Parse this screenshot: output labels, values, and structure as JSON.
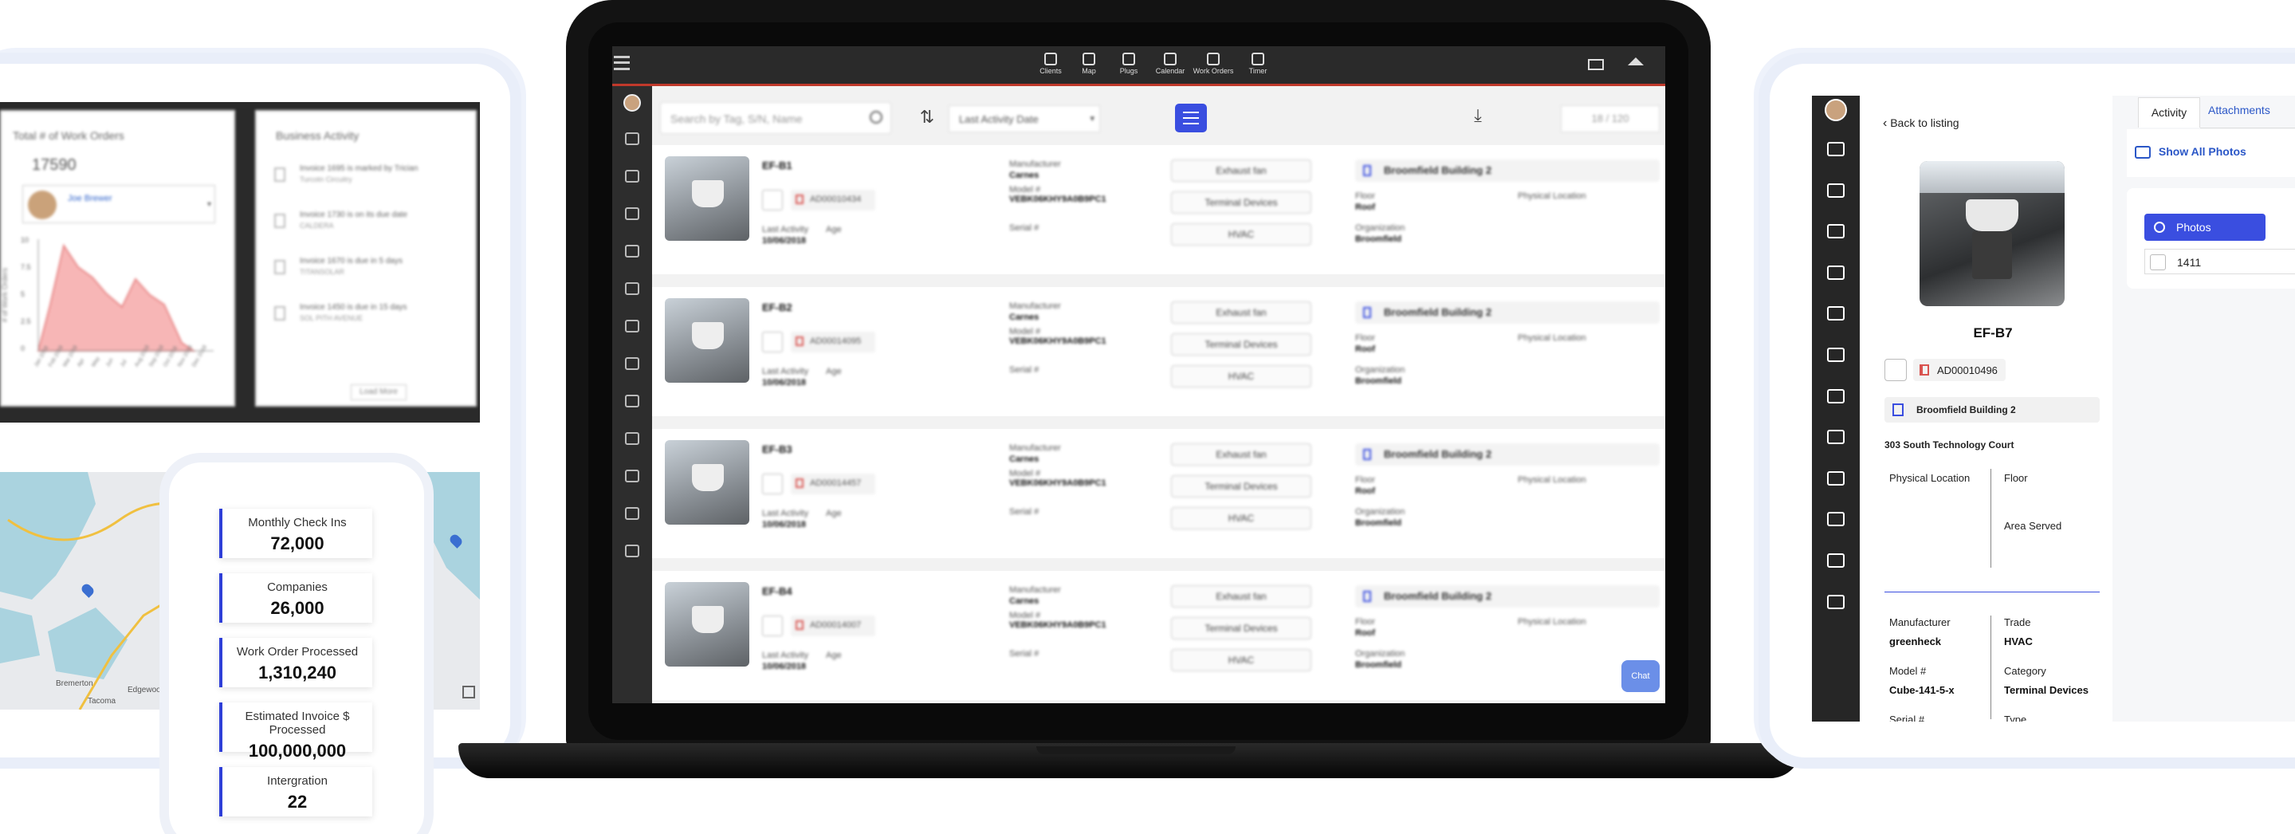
{
  "left_panel": {
    "work_orders_card": {
      "title": "Total # of Work Orders",
      "total": "17590",
      "user_name": "Joe Brewer",
      "y_axis_label": "# of Work Orders",
      "y_ticks": [
        "10",
        "7.5",
        "5",
        "2.5",
        "0"
      ],
      "x_ticks": [
        "Jan 2018",
        "Feb 2018",
        "Mar 2018",
        "Apr",
        "May",
        "Jun",
        "Jul",
        "Aug 2018",
        "Sep 2018",
        "Oct 2018",
        "Nov 2018",
        "Dec 2018"
      ]
    },
    "business_activity": {
      "title": "Business Activity",
      "items": [
        {
          "line1": "Invoice 1695 is marked by Trician",
          "line2": "Turcotn Circuitry"
        },
        {
          "line1": "Invoice 1730 is on its due date",
          "line2": "CALDERA"
        },
        {
          "line1": "Invoice 1670 is due in 5 days",
          "line2": "TITANSOLAR"
        },
        {
          "line1": "Invoice 1450 is due in 15 days",
          "line2": "SOL PITH AVENUE"
        }
      ],
      "load_more": "Load More"
    },
    "stats": [
      {
        "label": "Monthly Check Ins",
        "value": "72,000"
      },
      {
        "label": "Companies",
        "value": "26,000"
      },
      {
        "label": "Work Order Processed",
        "value": "1,310,240"
      },
      {
        "label": "Estimated Invoice $ Processed",
        "value": "100,000,000"
      },
      {
        "label": "Intergration",
        "value": "22"
      }
    ],
    "map_labels": [
      "Bremerton",
      "Edgewood",
      "Tacoma"
    ]
  },
  "laptop": {
    "nav": [
      {
        "icon": "clients-icon",
        "label": "Clients"
      },
      {
        "icon": "map-pin-icon",
        "label": "Map"
      },
      {
        "icon": "lightbulb-icon",
        "label": "Plugs"
      },
      {
        "icon": "calendar-icon",
        "label": "Calendar"
      },
      {
        "icon": "clipboard-icon",
        "label": "Work Orders"
      },
      {
        "icon": "timer-icon",
        "label": "Timer"
      }
    ],
    "search_placeholder": "Search by Tag, S/N, Name",
    "sort_value": "Last Activity Date",
    "pagination": "18 / 120",
    "chat_label": "Chat",
    "rows": [
      {
        "tag": "EF-B1",
        "id": "AD00010434",
        "last_activity_label": "Last Activity",
        "age_label": "Age",
        "last_activity": "10/06/2018",
        "manufacturer_label": "Manufacturer",
        "manufacturer": "Carnes",
        "model_label": "Model #",
        "model": "VEBK06KHY9A0B9PC1",
        "serial_label": "Serial #",
        "type": "Exhaust fan",
        "category": "Terminal Devices",
        "trade": "HVAC",
        "building": "Broomfield Building 2",
        "floor_label": "Floor",
        "floor": "Roof",
        "location_label": "Physical Location",
        "org_label": "Organization",
        "org": "Broomfield"
      },
      {
        "tag": "EF-B2",
        "id": "AD00014095",
        "last_activity_label": "Last Activity",
        "age_label": "Age",
        "last_activity": "10/06/2018",
        "manufacturer_label": "Manufacturer",
        "manufacturer": "Carnes",
        "model_label": "Model #",
        "model": "VEBK06KHY9A0B9PC1",
        "serial_label": "Serial #",
        "type": "Exhaust fan",
        "category": "Terminal Devices",
        "trade": "HVAC",
        "building": "Broomfield Building 2",
        "floor_label": "Floor",
        "floor": "Roof",
        "location_label": "Physical Location",
        "org_label": "Organization",
        "org": "Broomfield"
      },
      {
        "tag": "EF-B3",
        "id": "AD00014457",
        "last_activity_label": "Last Activity",
        "age_label": "Age",
        "last_activity": "10/06/2018",
        "manufacturer_label": "Manufacturer",
        "manufacturer": "Carnes",
        "model_label": "Model #",
        "model": "VEBK06KHY9A0B9PC1",
        "serial_label": "Serial #",
        "type": "Exhaust fan",
        "category": "Terminal Devices",
        "trade": "HVAC",
        "building": "Broomfield Building 2",
        "floor_label": "Floor",
        "floor": "Roof",
        "location_label": "Physical Location",
        "org_label": "Organization",
        "org": "Broomfield"
      },
      {
        "tag": "EF-B4",
        "id": "AD00014007",
        "last_activity_label": "Last Activity",
        "age_label": "Age",
        "last_activity": "10/06/2018",
        "manufacturer_label": "Manufacturer",
        "manufacturer": "Carnes",
        "model_label": "Model #",
        "model": "VEBK06KHY9A0B9PC1",
        "serial_label": "Serial #",
        "type": "Exhaust fan",
        "category": "Terminal Devices",
        "trade": "HVAC",
        "building": "Broomfield Building 2",
        "floor_label": "Floor",
        "floor": "Roof",
        "location_label": "Physical Location",
        "org_label": "Organization",
        "org": "Broomfield"
      }
    ]
  },
  "right_panel": {
    "back_link": "Back to listing",
    "asset_tag": "EF-B7",
    "asset_id": "AD00010496",
    "building": "Broomfield Building 2",
    "address": "303 South Technology Court",
    "physical_location_label": "Physical Location",
    "floor_label": "Floor",
    "area_served_label": "Area Served",
    "manufacturer_label": "Manufacturer",
    "manufacturer": "greenheck",
    "trade_label": "Trade",
    "trade": "HVAC",
    "model_label": "Model #",
    "model": "Cube-141-5-x",
    "category_label": "Category",
    "category": "Terminal Devices",
    "serial_label": "Serial #",
    "type_label": "Type",
    "tabs": [
      "Activity",
      "Attachments"
    ],
    "show_all_photos": "Show All Photos",
    "photos_button": "Photos",
    "photo_item": "1411"
  },
  "colors": {
    "accent_blue": "#3344e0",
    "alert_red": "#d9534f",
    "chart_fill": "#f7b6b6",
    "chart_line": "#e88a8a"
  }
}
